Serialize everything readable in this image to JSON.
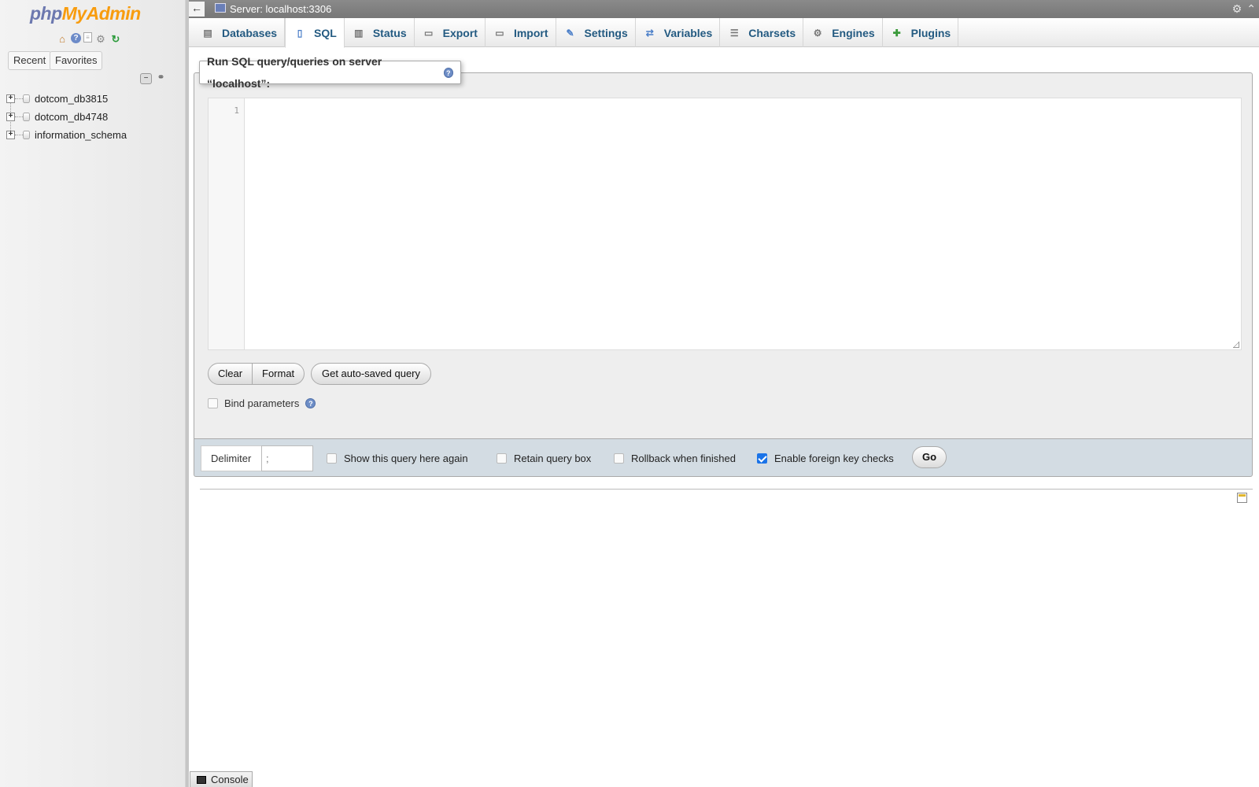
{
  "logo": {
    "part1": "php",
    "part2": "MyAdmin"
  },
  "nav": {
    "icons": [
      "home-icon",
      "help-icon",
      "docs-icon",
      "settings-icon",
      "reload-icon"
    ],
    "recent_label": "Recent",
    "favorites_label": "Favorites",
    "databases": [
      {
        "name": "dotcom_db3815"
      },
      {
        "name": "dotcom_db4748"
      },
      {
        "name": "information_schema"
      }
    ]
  },
  "topbar": {
    "server_label": "Server: localhost:3306"
  },
  "menu": {
    "tabs": [
      {
        "label": "Databases",
        "icon": "database-icon",
        "active": false
      },
      {
        "label": "SQL",
        "icon": "sql-icon",
        "active": true
      },
      {
        "label": "Status",
        "icon": "status-icon",
        "active": false
      },
      {
        "label": "Export",
        "icon": "export-icon",
        "active": false
      },
      {
        "label": "Import",
        "icon": "import-icon",
        "active": false
      },
      {
        "label": "Settings",
        "icon": "wrench-icon",
        "active": false
      },
      {
        "label": "Variables",
        "icon": "variables-icon",
        "active": false
      },
      {
        "label": "Charsets",
        "icon": "charsets-icon",
        "active": false
      },
      {
        "label": "Engines",
        "icon": "engines-icon",
        "active": false
      },
      {
        "label": "Plugins",
        "icon": "plugins-icon",
        "active": false
      }
    ]
  },
  "sql": {
    "legend": "Run SQL query/queries on server “localhost”:",
    "line_number": "1",
    "query": "",
    "clear_label": "Clear",
    "format_label": "Format",
    "autosaved_label": "Get auto-saved query",
    "bind_label": "Bind parameters"
  },
  "tools": {
    "delimiter_label": "Delimiter",
    "delimiter_value": ";",
    "show_again_label": "Show this query here again",
    "retain_label": "Retain query box",
    "rollback_label": "Rollback when finished",
    "fk_label": "Enable foreign key checks",
    "go_label": "Go"
  },
  "console": {
    "label": "Console"
  },
  "colors": {
    "link": "#235a81",
    "accent_orange": "#f89c0e",
    "accent_purple": "#6c78af",
    "tools_bg": "#d3dce3"
  }
}
